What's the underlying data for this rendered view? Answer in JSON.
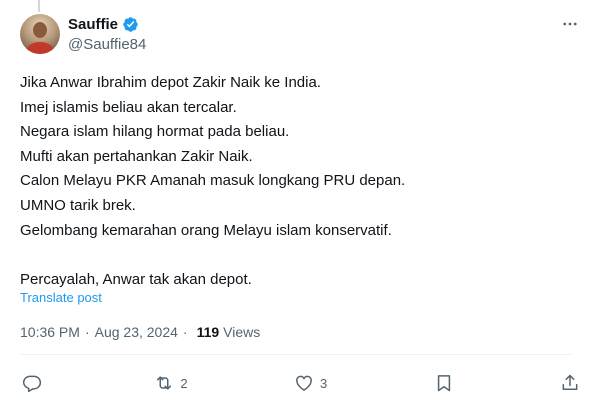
{
  "user": {
    "display_name": "Sauffie",
    "handle": "@Sauffie84"
  },
  "tweet": {
    "lines": [
      "Jika Anwar Ibrahim depot Zakir Naik ke India.",
      "Imej islamis beliau akan tercalar.",
      "Negara islam hilang hormat pada beliau.",
      "Mufti akan pertahankan Zakir Naik.",
      "Calon Melayu PKR Amanah masuk longkang PRU depan.",
      "UMNO tarik brek.",
      "Gelombang kemarahan orang Melayu islam konservatif."
    ],
    "closing": "Percayalah, Anwar tak akan depot."
  },
  "translate_label": "Translate post",
  "meta": {
    "time": "10:36 PM",
    "separator": "·",
    "date": "Aug 23, 2024",
    "views_count": "119",
    "views_label": "Views"
  },
  "actions": {
    "reply_count": "",
    "repost_count": "2",
    "like_count": "3"
  },
  "icons": {
    "more": "more-dots-icon",
    "verified": "verified-badge-icon",
    "reply": "reply-icon",
    "repost": "repost-icon",
    "like": "heart-icon",
    "bookmark": "bookmark-icon",
    "share": "share-icon"
  },
  "colors": {
    "accent": "#1d9bf0",
    "text": "#0f1419",
    "secondary": "#536471"
  }
}
